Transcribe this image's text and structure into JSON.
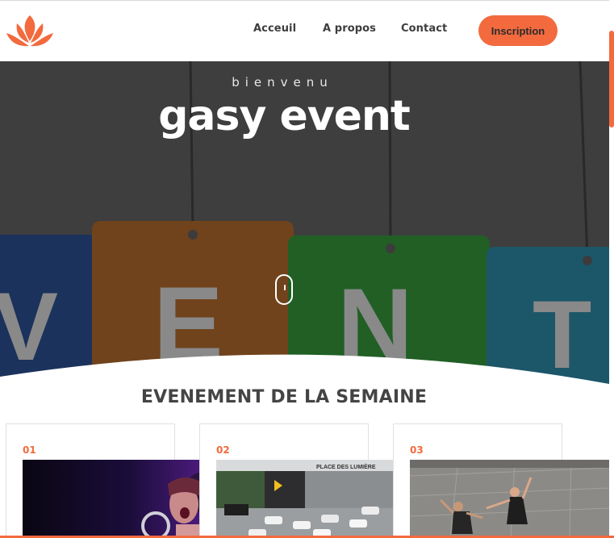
{
  "nav": {
    "links": [
      "Acceuil",
      "A propos",
      "Contact"
    ],
    "cta": "Inscription"
  },
  "hero": {
    "subtitle": "bienvenu",
    "title": "gasy event",
    "sign_letters": [
      "V",
      "E",
      "N",
      "T"
    ]
  },
  "section": {
    "title": "EVENEMENT DE LA SEMAINE",
    "cards": [
      {
        "num": "01"
      },
      {
        "num": "02",
        "image_text": "PLACE DES LUMIÈRE"
      },
      {
        "num": "03"
      }
    ]
  },
  "colors": {
    "accent": "#f26a3e",
    "text": "#3d3d3d"
  }
}
